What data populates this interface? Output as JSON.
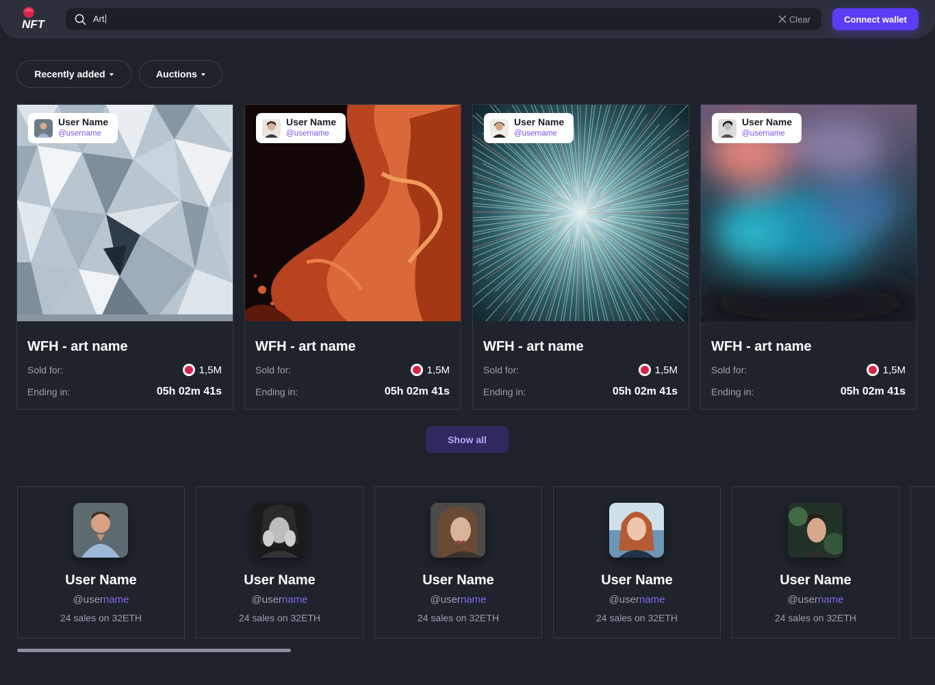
{
  "header": {
    "logo_text": "NFT",
    "search": {
      "value": "Art",
      "placeholder": ""
    },
    "clear_label": "Clear",
    "connect_label": "Connect wallet"
  },
  "filters": [
    {
      "label": "Recently added",
      "icon": "caret-down-icon"
    },
    {
      "label": "Auctions",
      "icon": "caret-down-icon"
    }
  ],
  "cards": [
    {
      "owner_name": "User Name",
      "owner_username": "@username",
      "title": "WFH - art name",
      "sold_label": "Sold for:",
      "sold_value": "1,5M",
      "ending_label": "Ending in:",
      "ending_value": "05h 02m 41s"
    },
    {
      "owner_name": "User Name",
      "owner_username": "@username",
      "title": "WFH - art name",
      "sold_label": "Sold for:",
      "sold_value": "1,5M",
      "ending_label": "Ending in:",
      "ending_value": "05h 02m 41s"
    },
    {
      "owner_name": "User Name",
      "owner_username": "@username",
      "title": "WFH - art name",
      "sold_label": "Sold for:",
      "sold_value": "1,5M",
      "ending_label": "Ending in:",
      "ending_value": "05h 02m 41s"
    },
    {
      "owner_name": "User Name",
      "owner_username": "@username",
      "title": "WFH - art name",
      "sold_label": "Sold for:",
      "sold_value": "1,5M",
      "ending_label": "Ending in:",
      "ending_value": "05h 02m 41s"
    }
  ],
  "show_all_label": "Show all",
  "creators": [
    {
      "name": "User Name",
      "at": "@user",
      "rest": "name",
      "sales": "24 sales on 32ETH"
    },
    {
      "name": "User Name",
      "at": "@user",
      "rest": "name",
      "sales": "24 sales on 32ETH"
    },
    {
      "name": "User Name",
      "at": "@user",
      "rest": "name",
      "sales": "24 sales on 32ETH"
    },
    {
      "name": "User Name",
      "at": "@user",
      "rest": "name",
      "sales": "24 sales on 32ETH"
    },
    {
      "name": "User Name",
      "at": "@user",
      "rest": "name",
      "sales": "24 sales on 32ETH"
    }
  ],
  "colors": {
    "background": "#1e222b",
    "accent": "#5b3df5",
    "username": "#8b62f0",
    "card_border": "#343946"
  }
}
